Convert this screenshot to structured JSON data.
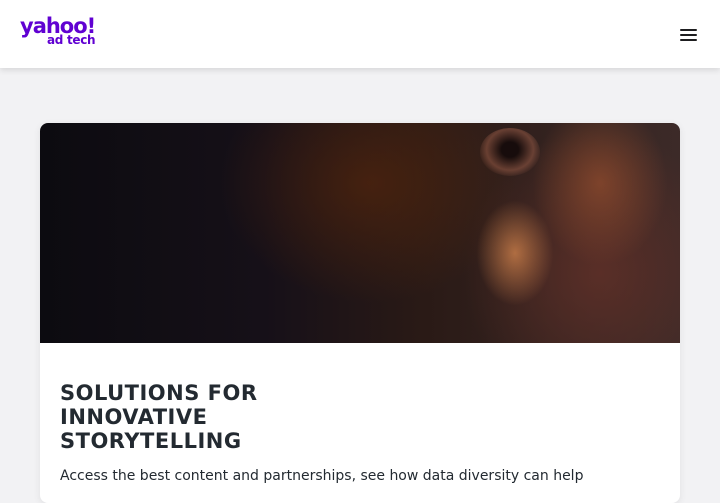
{
  "header": {
    "logo": {
      "brand": "yahoo!",
      "sub": "ad tech",
      "color": "#6001d2"
    },
    "menu_icon": "hamburger-menu-icon"
  },
  "card": {
    "image_subject": "Close-up of a face in dim warm light",
    "title": "SOLUTIONS FOR INNOVATIVE STORYTELLING",
    "description": "Access the best content and partnerships, see how data diversity can help"
  }
}
